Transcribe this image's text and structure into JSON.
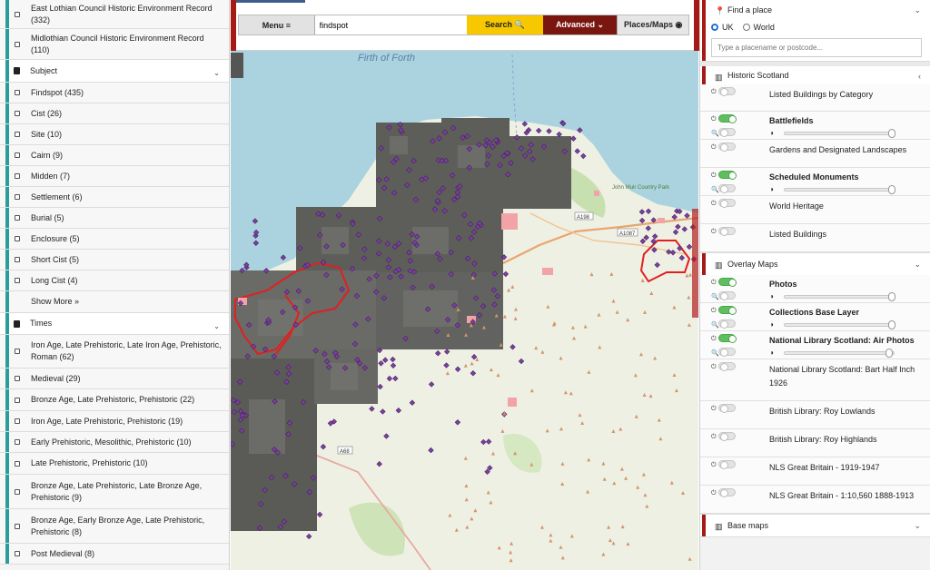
{
  "left_sidebar": {
    "top_items": [
      {
        "label": "East Lothian Council Historic Environment Record (332)"
      },
      {
        "label": "Midlothian Council Historic Environment Record (110)"
      }
    ],
    "subject": {
      "heading": "Subject",
      "items": [
        {
          "label": "Findspot (435)"
        },
        {
          "label": "Cist (26)"
        },
        {
          "label": "Site (10)"
        },
        {
          "label": "Cairn (9)"
        },
        {
          "label": "Midden (7)"
        },
        {
          "label": "Settlement (6)"
        },
        {
          "label": "Burial (5)"
        },
        {
          "label": "Enclosure (5)"
        },
        {
          "label": "Short Cist (5)"
        },
        {
          "label": "Long Cist (4)"
        }
      ],
      "show_more": "Show More »"
    },
    "times": {
      "heading": "Times",
      "items": [
        {
          "label": "Iron Age, Late Prehistoric, Late Iron Age, Prehistoric, Roman (62)"
        },
        {
          "label": "Medieval (29)"
        },
        {
          "label": "Bronze Age, Late Prehistoric, Prehistoric (22)"
        },
        {
          "label": "Iron Age, Late Prehistoric, Prehistoric (19)"
        },
        {
          "label": "Early Prehistoric, Mesolithic, Prehistoric (10)"
        },
        {
          "label": "Late Prehistoric, Prehistoric (10)"
        },
        {
          "label": "Bronze Age, Late Prehistoric, Late Bronze Age, Prehistoric (9)"
        },
        {
          "label": "Bronze Age, Early Bronze Age, Late Prehistoric, Prehistoric (8)"
        },
        {
          "label": "Post Medieval (8)"
        }
      ]
    }
  },
  "toolbar": {
    "menu_label": "Menu ≡",
    "search_value": "findspot",
    "search_label": "Search 🔍",
    "advanced_label": "Advanced ⌄",
    "places_label": "Places/Maps ◉"
  },
  "map": {
    "sea_label": "Firth of Forth",
    "road_a": "A198",
    "road_b": "A1087",
    "road_c": "A68",
    "place_label": "John Muir Country Park"
  },
  "right_sidebar": {
    "find_place": {
      "heading": "Find a place",
      "radio_uk": "UK",
      "radio_world": "World",
      "placeholder": "Type a placename or postcode..."
    },
    "historic_scotland": {
      "heading": "Historic Scotland",
      "layers": [
        {
          "label": "Listed Buildings by Category",
          "on": false,
          "bold": false
        },
        {
          "label": "Battlefields",
          "on": true,
          "bold": true,
          "slider": 1.0
        },
        {
          "label": "Gardens and Designated Landscapes",
          "on": false,
          "bold": false
        },
        {
          "label": "Scheduled Monuments",
          "on": true,
          "bold": true,
          "slider": 1.0
        },
        {
          "label": "World Heritage",
          "on": false,
          "bold": false
        },
        {
          "label": "Listed Buildings",
          "on": false,
          "bold": false
        }
      ]
    },
    "overlay_maps": {
      "heading": "Overlay Maps",
      "layers": [
        {
          "label": "Photos",
          "on": true,
          "bold": true,
          "slider": 1.0
        },
        {
          "label": "Collections Base Layer",
          "on": true,
          "bold": true,
          "slider": 1.0
        },
        {
          "label": "National Library Scotland: Air Photos",
          "on": true,
          "bold": true,
          "slider": 0.97
        },
        {
          "label": "National Library Scotland: Bart Half Inch 1926",
          "on": false,
          "bold": false
        },
        {
          "label": "British Library: Roy Lowlands",
          "on": false,
          "bold": false
        },
        {
          "label": "British Library: Roy Highlands",
          "on": false,
          "bold": false
        },
        {
          "label": "NLS Great Britain - 1919-1947",
          "on": false,
          "bold": false
        },
        {
          "label": "NLS Great Britain - 1:10,560 1888-1913",
          "on": false,
          "bold": false
        }
      ]
    },
    "base_maps": {
      "heading": "Base maps"
    }
  },
  "colors": {
    "teal": "#2a9d9a",
    "maroon": "#a51a14",
    "yellow": "#f7c800",
    "dark_red": "#7a1610"
  }
}
